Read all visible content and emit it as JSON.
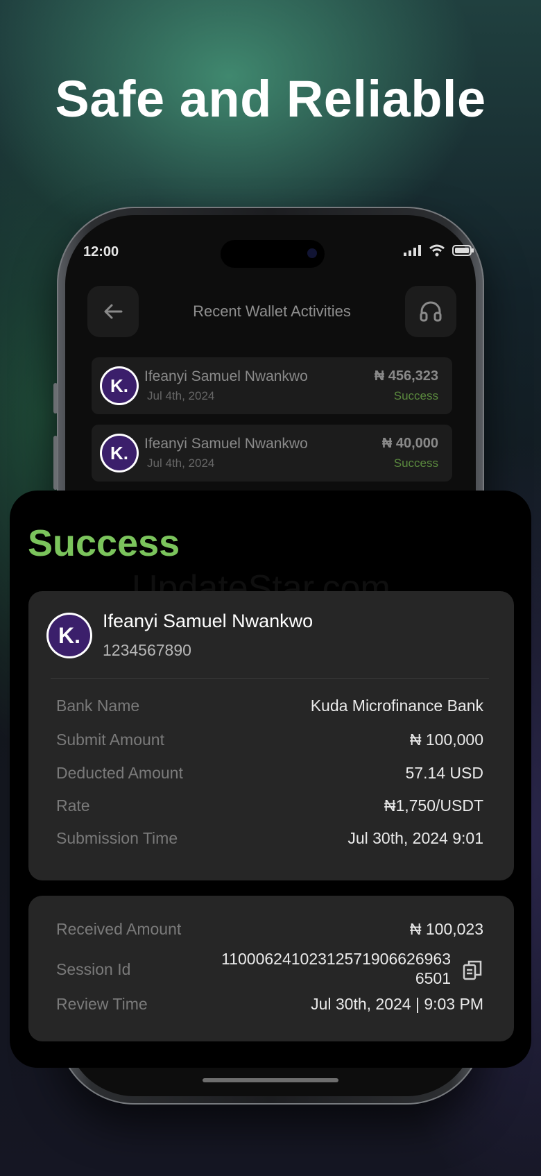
{
  "headline": "Safe and Reliable",
  "phone": {
    "status_time": "12:00",
    "header_title": "Recent Wallet Activities",
    "activities": [
      {
        "name": "Ifeanyi Samuel Nwankwo",
        "date": "Jul 4th, 2024",
        "amount": "₦ 456,323",
        "status": "Success"
      },
      {
        "name": "Ifeanyi Samuel Nwankwo",
        "date": "Jul 4th, 2024",
        "amount": "₦ 40,000",
        "status": "Success"
      }
    ]
  },
  "detail": {
    "status_title": "Success",
    "watermark": "UpdateStar.com",
    "recipient_name": "Ifeanyi Samuel Nwankwo",
    "recipient_account": "1234567890",
    "logo_letter": "K.",
    "rows": [
      {
        "label": "Bank Name",
        "value": "Kuda Microfinance Bank"
      },
      {
        "label": "Submit Amount",
        "value": "₦ 100,000"
      },
      {
        "label": "Deducted Amount",
        "value": "57.14 USD"
      },
      {
        "label": "Rate",
        "value": "₦1,750/USDT"
      },
      {
        "label": "Submission Time",
        "value": "Jul 30th, 2024 9:01"
      }
    ],
    "received": {
      "label": "Received Amount",
      "value": "₦ 100,023"
    },
    "session": {
      "label": "Session Id",
      "value_line1": "110006241023125719066269 63",
      "value_line1_display": "110006241023125719066269 63",
      "line1": "11000624102312571906626963",
      "line2": "6501"
    },
    "review": {
      "label": "Review Time",
      "value": "Jul 30th, 2024 | 9:03 PM"
    }
  },
  "colors": {
    "success": "#7bc45c",
    "card_bg": "#262626",
    "brand_purple": "#3b1f6b"
  }
}
